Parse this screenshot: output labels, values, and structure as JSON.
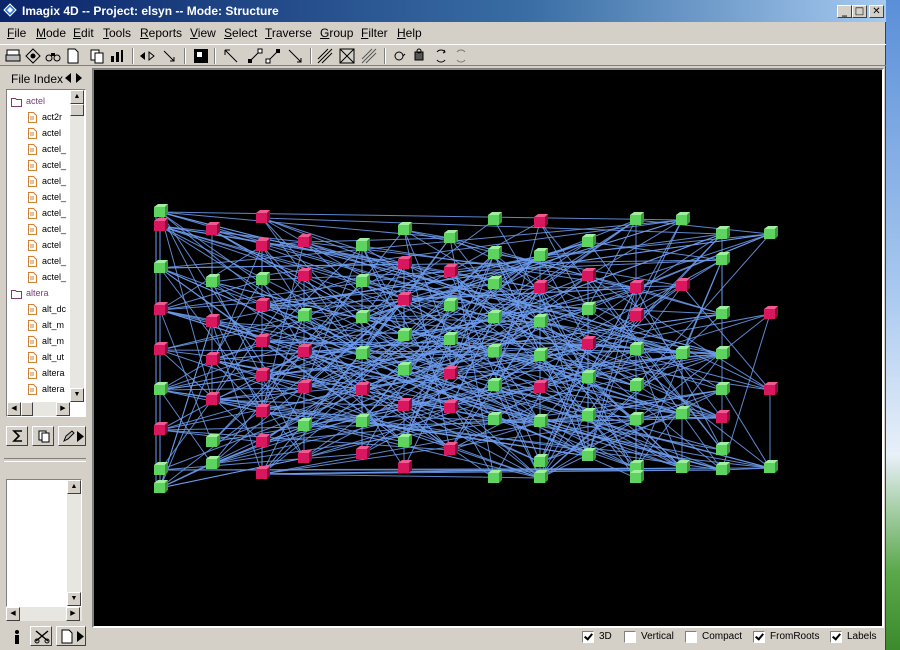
{
  "window": {
    "title": "Imagix 4D -- Project: elsyn -- Mode: Structure",
    "minimize_label": "_",
    "maximize_label": "□",
    "close_label": "✕"
  },
  "menu": [
    "File",
    "Mode",
    "Edit",
    "Tools",
    "Reports",
    "View",
    "Select",
    "Traverse",
    "Group",
    "Filter",
    "Help"
  ],
  "toolbar_icons": [
    "print-icon",
    "find-icon",
    "binoculars-icon",
    "document-icon",
    "copy-icon",
    "chart-icon",
    "back-forward-icon",
    "graph-select-icon",
    "pointer-icon",
    "expand-icon",
    "collapse-icon",
    "layout-a-icon",
    "layout-b-icon",
    "layout-c-icon",
    "rotate-a-icon",
    "rotate-b-icon",
    "rotate-c-icon",
    "rotate-d-icon"
  ],
  "file_index": {
    "title": "File Index",
    "items": [
      {
        "type": "folder",
        "label": "actel"
      },
      {
        "type": "file",
        "label": "act2r"
      },
      {
        "type": "file",
        "label": "actel"
      },
      {
        "type": "file",
        "label": "actel_"
      },
      {
        "type": "file",
        "label": "actel_"
      },
      {
        "type": "file",
        "label": "actel_"
      },
      {
        "type": "file",
        "label": "actel_"
      },
      {
        "type": "file",
        "label": "actel_"
      },
      {
        "type": "file",
        "label": "actel_"
      },
      {
        "type": "file",
        "label": "actel"
      },
      {
        "type": "file",
        "label": "actel_"
      },
      {
        "type": "file",
        "label": "actel_"
      },
      {
        "type": "folder",
        "label": "altera"
      },
      {
        "type": "file",
        "label": "alt_dc"
      },
      {
        "type": "file",
        "label": "alt_m"
      },
      {
        "type": "file",
        "label": "alt_m"
      },
      {
        "type": "file",
        "label": "alt_ut"
      },
      {
        "type": "file",
        "label": "altera"
      },
      {
        "type": "file",
        "label": "altera"
      }
    ]
  },
  "view_options": [
    {
      "label": "3D",
      "checked": true
    },
    {
      "label": "Vertical",
      "checked": false
    },
    {
      "label": "Compact",
      "checked": false
    },
    {
      "label": "FromRoots",
      "checked": true
    },
    {
      "label": "Labels",
      "checked": true
    }
  ],
  "colors": {
    "edge": "#6e9ef0",
    "node_green": "#5fd35f",
    "node_magenta": "#d8175e",
    "background": "#000000"
  }
}
